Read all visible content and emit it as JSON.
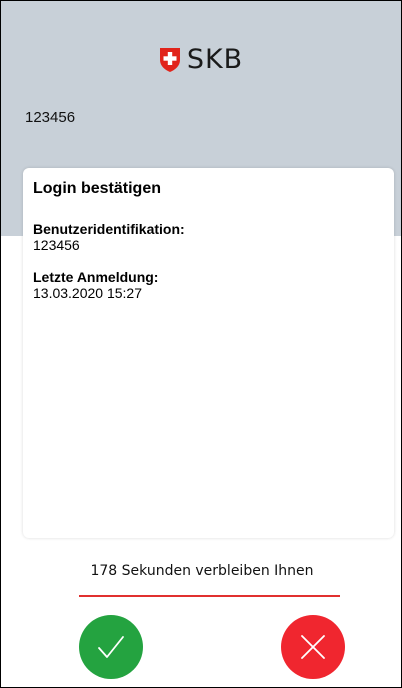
{
  "header": {
    "brand_name": "SKB",
    "logo_icon": "swiss-cross-shield-icon",
    "user_id": "123456",
    "background": "#c8d0d8"
  },
  "card": {
    "title": "Login bestätigen",
    "fields": [
      {
        "label": "Benutzeridentifikation:",
        "value": "123456"
      },
      {
        "label": "Letzte Anmeldung:",
        "value": "13.03.2020 15:27"
      }
    ]
  },
  "countdown": {
    "text": "178 Sekunden verbleiben Ihnen",
    "progress": 1.0,
    "color": "#e1302f"
  },
  "actions": {
    "confirm_icon": "checkmark-icon",
    "confirm_color": "#24a340",
    "reject_icon": "close-icon",
    "reject_color": "#f0262f"
  }
}
